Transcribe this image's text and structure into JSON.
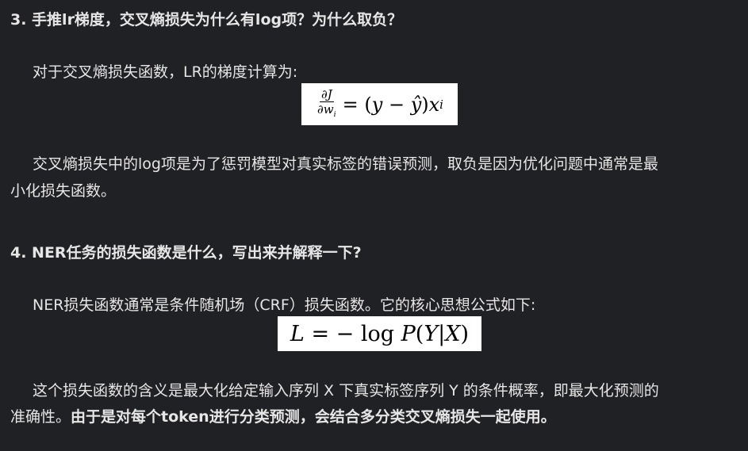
{
  "sections": [
    {
      "heading": "3. 手推lr梯度，交叉熵损失为什么有log项？为什么取负？",
      "intro": "对于交叉熵损失函数，LR的梯度计算为:",
      "equation": {
        "frac_num": "∂J",
        "frac_den": "∂w",
        "frac_den_sub": "i",
        "rhs_prefix": "= (",
        "rhs_y": "y",
        "rhs_minus": " − ",
        "rhs_yhat": "ŷ",
        "rhs_close": ")",
        "rhs_x": "x",
        "rhs_x_sub": "i"
      },
      "para_line1": "交叉熵损失中的log项是为了惩罚模型对真实标签的错误预测，取负是因为优化问题中通常是最",
      "para_line2": "小化损失函数。"
    },
    {
      "heading": "4. NER任务的损失函数是什么，写出来并解释一下?",
      "intro": "NER损失函数通常是条件随机场（CRF）损失函数。它的核心思想公式如下:",
      "equation": {
        "lhs": "L",
        "rhs_eq": " = − log ",
        "P": "P",
        "open": "(",
        "Y": "Y",
        "bar": "|",
        "X": "X",
        "close": ")"
      },
      "para_line1": "这个损失函数的含义是最大化给定输入序列 X 下真实标签序列 Y 的条件概率，即最大化预测的",
      "para_line2_normal": "准确性。",
      "para_line2_bold": "由于是对每个token进行分类预测，会结合多分类交叉熵损失一起使用。"
    }
  ]
}
